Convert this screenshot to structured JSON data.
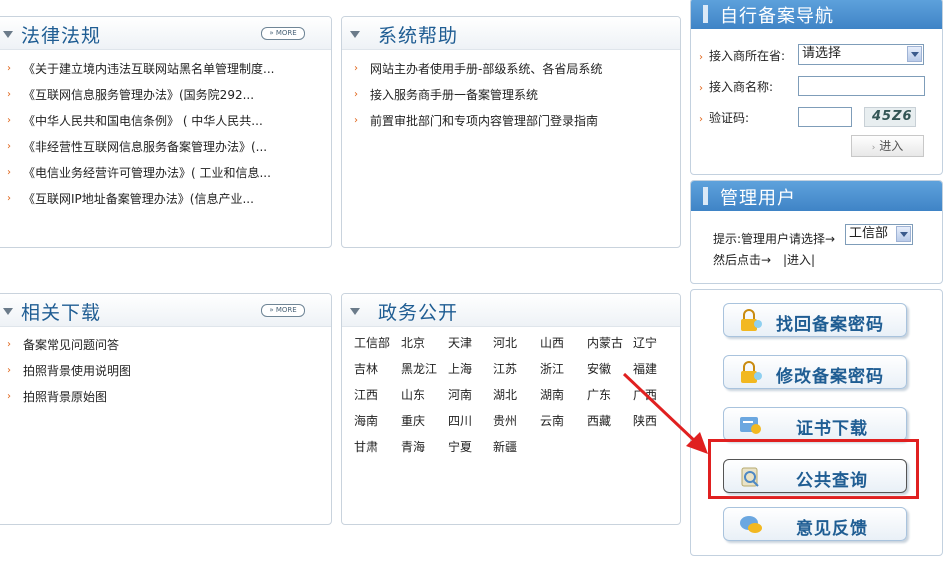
{
  "law": {
    "title": "法律法规",
    "more": "» MORE",
    "items": [
      "《关于建立境内违法互联网站黑名单管理制度...",
      "《互联网信息服务管理办法》(国务院292...",
      "《中华人民共和国电信条例》 ( 中华人民共...",
      "《非经营性互联网信息服务备案管理办法》(...",
      "《电信业务经营许可管理办法》( 工业和信息...",
      "《互联网IP地址备案管理办法》(信息产业..."
    ]
  },
  "help": {
    "title": "系统帮助",
    "items": [
      "网站主办者使用手册-部级系统、各省局系统",
      "接入服务商手册一备案管理系统",
      "前置审批部门和专项内容管理部门登录指南"
    ]
  },
  "download": {
    "title": "相关下载",
    "more": "» MORE",
    "items": [
      "备案常见问题问答",
      "拍照背景使用说明图",
      "拍照背景原始图"
    ]
  },
  "gov": {
    "title": "政务公开",
    "regions": [
      [
        "工信部",
        "北京",
        "天津",
        "河北",
        "山西",
        "内蒙古",
        "辽宁"
      ],
      [
        "吉林",
        "黑龙江",
        "上海",
        "江苏",
        "浙江",
        "安徽",
        "福建"
      ],
      [
        "江西",
        "山东",
        "河南",
        "湖北",
        "湖南",
        "广东",
        "广西"
      ],
      [
        "海南",
        "重庆",
        "四川",
        "贵州",
        "云南",
        "西藏",
        "陕西"
      ],
      [
        "甘肃",
        "青海",
        "宁夏",
        "新疆"
      ]
    ]
  },
  "nav": {
    "title": "自行备案导航",
    "province_label": "接入商所在省:",
    "province_value": "请选择",
    "name_label": "接入商名称:",
    "captcha_label": "验证码:",
    "captcha_text": "45Z6",
    "enter": "进入"
  },
  "admin": {
    "title": "管理用户",
    "hint": "提示:管理用户请选择→",
    "select_value": "工信部",
    "then": "然后点击→",
    "enter_link": "|进入|"
  },
  "buttons": {
    "recover": "找回备案密码",
    "modify": "修改备案密码",
    "cert": "证书下载",
    "query": "公共查询",
    "feedback": "意见反馈"
  },
  "colors": {
    "title": "#1f5d93",
    "bullet": "#e0651a",
    "highlight": "#e02020",
    "side_header": "#4a8fd0"
  }
}
